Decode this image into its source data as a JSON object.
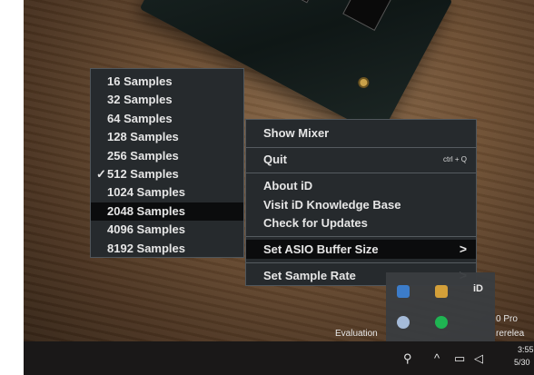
{
  "buffer_submenu": {
    "items": [
      {
        "label": "16 Samples",
        "checked": false,
        "highlighted": false
      },
      {
        "label": "32 Samples",
        "checked": false,
        "highlighted": false
      },
      {
        "label": "64 Samples",
        "checked": false,
        "highlighted": false
      },
      {
        "label": "128 Samples",
        "checked": false,
        "highlighted": false
      },
      {
        "label": "256 Samples",
        "checked": false,
        "highlighted": false
      },
      {
        "label": "512 Samples",
        "checked": true,
        "highlighted": false
      },
      {
        "label": "1024 Samples",
        "checked": false,
        "highlighted": false
      },
      {
        "label": "2048 Samples",
        "checked": false,
        "highlighted": true
      },
      {
        "label": "4096 Samples",
        "checked": false,
        "highlighted": false
      },
      {
        "label": "8192 Samples",
        "checked": false,
        "highlighted": false
      }
    ],
    "check_glyph": "✓"
  },
  "context_menu": {
    "show_mixer": "Show Mixer",
    "quit": "Quit",
    "quit_shortcut": "ctrl + Q",
    "about": "About iD",
    "visit_kb": "Visit iD Knowledge Base",
    "check_updates": "Check for Updates",
    "set_buffer": "Set ASIO Buffer Size",
    "set_rate": "Set Sample Rate",
    "arrow_glyph": ">"
  },
  "tray_popup": {
    "id_label": "iD"
  },
  "desktop": {
    "evaluation_text": "Evaluation",
    "right_text_1": "0 Pro",
    "right_text_2": "rerelea"
  },
  "taskbar": {
    "time": "3:55",
    "date": "5/30"
  },
  "colors": {
    "menu_bg": "#262a2d",
    "highlight_bg": "#0b0c0d",
    "menu_text": "#e6e6e6",
    "taskbar_bg": "#1a1818"
  }
}
